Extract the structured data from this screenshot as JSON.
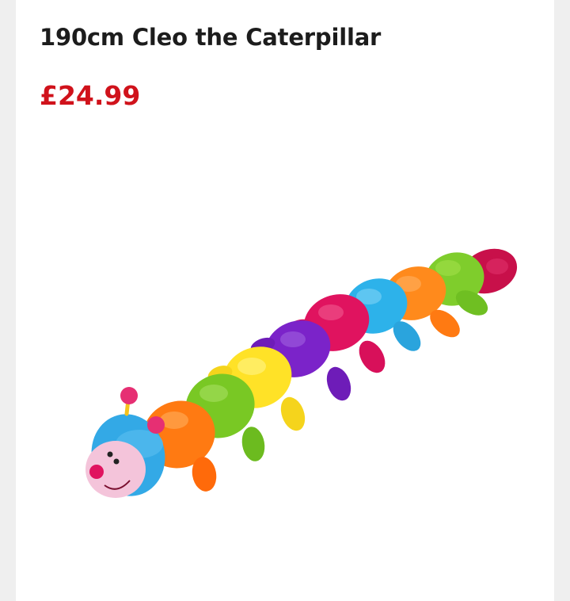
{
  "product": {
    "title": "190cm Cleo the Caterpillar",
    "price": "£24.99",
    "price_color": "#d0121b",
    "image": {
      "icon": "caterpillar-plush-image",
      "segment_colors": [
        "#ff7a12",
        "#79c824",
        "#ffe227",
        "#7b23c9",
        "#e0135f",
        "#2db2ea",
        "#ff8a1c",
        "#7fcd2c",
        "#c8104a"
      ],
      "head_color": "#33a9e6",
      "face_color": "#f4c4da",
      "antenna_color": "#e62f73"
    }
  }
}
